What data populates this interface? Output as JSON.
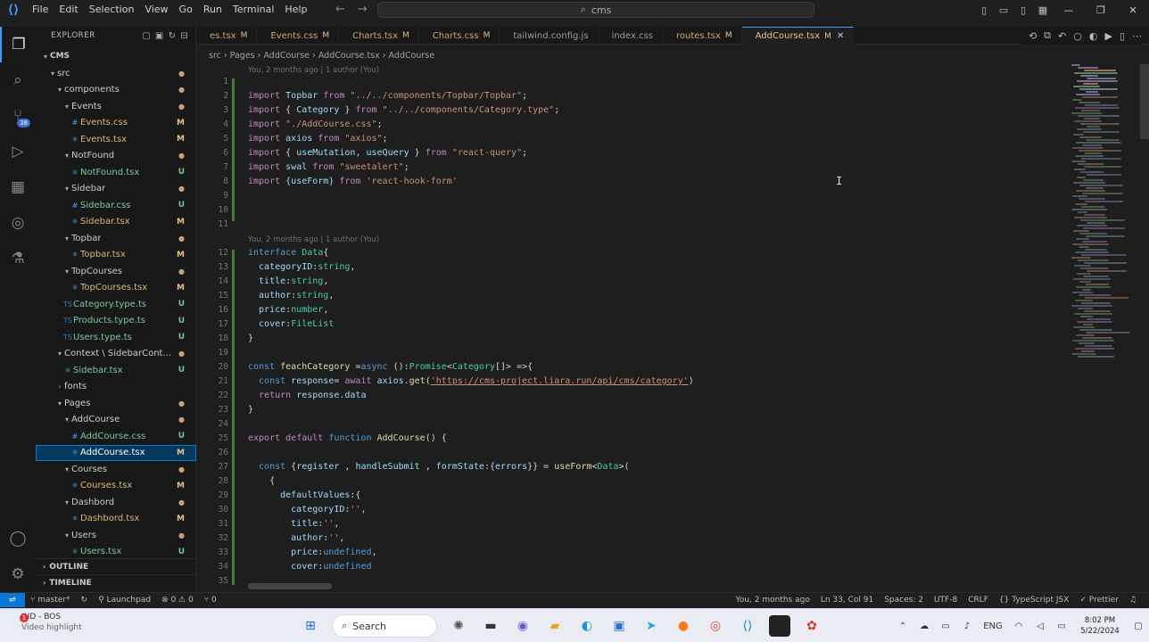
{
  "titlebar": {
    "logo": "⟨⟩",
    "menu": [
      "File",
      "Edit",
      "Selection",
      "View",
      "Go",
      "Run",
      "Terminal",
      "Help"
    ],
    "search_text": "cms",
    "icons": [
      "layout-sidebar-left-icon",
      "layout-panel-icon",
      "layout-sidebar-right-icon",
      "customize-layout-icon"
    ],
    "window": [
      "—",
      "❐",
      "✕"
    ]
  },
  "activity": [
    "explorer-icon",
    "search-icon",
    "source-control-icon",
    "run-debug-icon",
    "extensions-icon",
    "remote-explorer-icon",
    "testing-icon"
  ],
  "activity_badge": "38",
  "sidebar": {
    "title": "EXPLORER",
    "root": "CMS",
    "tree": [
      {
        "name": "src",
        "depth": 1,
        "kind": "folder",
        "status": "dot"
      },
      {
        "name": "components",
        "depth": 2,
        "kind": "folder",
        "status": "dot"
      },
      {
        "name": "Events",
        "depth": 3,
        "kind": "folder",
        "status": "dot"
      },
      {
        "name": "Events.css",
        "depth": 4,
        "kind": "css",
        "status": "M"
      },
      {
        "name": "Events.tsx",
        "depth": 4,
        "kind": "tsx",
        "status": "M"
      },
      {
        "name": "NotFound",
        "depth": 3,
        "kind": "folder",
        "status": "dot"
      },
      {
        "name": "NotFound.tsx",
        "depth": 4,
        "kind": "tsx",
        "status": "U"
      },
      {
        "name": "Sidebar",
        "depth": 3,
        "kind": "folder",
        "status": "dot"
      },
      {
        "name": "Sidebar.css",
        "depth": 4,
        "kind": "css",
        "status": "U"
      },
      {
        "name": "Sidebar.tsx",
        "depth": 4,
        "kind": "tsx",
        "status": "M"
      },
      {
        "name": "Topbar",
        "depth": 3,
        "kind": "folder",
        "status": "dot"
      },
      {
        "name": "Topbar.tsx",
        "depth": 4,
        "kind": "tsx",
        "status": "M"
      },
      {
        "name": "TopCourses",
        "depth": 3,
        "kind": "folder",
        "status": "dot"
      },
      {
        "name": "TopCourses.tsx",
        "depth": 4,
        "kind": "tsx",
        "status": "M"
      },
      {
        "name": "Category.type.ts",
        "depth": 3,
        "kind": "ts",
        "status": "U"
      },
      {
        "name": "Products.type.ts",
        "depth": 3,
        "kind": "ts",
        "status": "U"
      },
      {
        "name": "Users.type.ts",
        "depth": 3,
        "kind": "ts",
        "status": "U"
      },
      {
        "name": "Context \\ SidebarCont...",
        "depth": 2,
        "kind": "folder",
        "status": "dot"
      },
      {
        "name": "Sidebar.tsx",
        "depth": 3,
        "kind": "tsx",
        "status": "U"
      },
      {
        "name": "fonts",
        "depth": 2,
        "kind": "folder-closed",
        "status": ""
      },
      {
        "name": "Pages",
        "depth": 2,
        "kind": "folder",
        "status": "dot"
      },
      {
        "name": "AddCourse",
        "depth": 3,
        "kind": "folder",
        "status": "dot"
      },
      {
        "name": "AddCourse.css",
        "depth": 4,
        "kind": "css",
        "status": "U"
      },
      {
        "name": "AddCourse.tsx",
        "depth": 4,
        "kind": "tsx",
        "status": "M",
        "selected": true
      },
      {
        "name": "Courses",
        "depth": 3,
        "kind": "folder",
        "status": "dot"
      },
      {
        "name": "Courses.tsx",
        "depth": 4,
        "kind": "tsx",
        "status": "M"
      },
      {
        "name": "Dashbord",
        "depth": 3,
        "kind": "folder",
        "status": "dot"
      },
      {
        "name": "Dashbord.tsx",
        "depth": 4,
        "kind": "tsx",
        "status": "M"
      },
      {
        "name": "Users",
        "depth": 3,
        "kind": "folder",
        "status": "dot"
      },
      {
        "name": "Users.tsx",
        "depth": 4,
        "kind": "tsx",
        "status": "U"
      }
    ],
    "outline": "OUTLINE",
    "timeline": "TIMELINE"
  },
  "tabs": [
    {
      "name": "es.tsx",
      "icon": "⚛",
      "status": "M"
    },
    {
      "name": "Events.css",
      "icon": "#",
      "status": "M"
    },
    {
      "name": "Charts.tsx",
      "icon": "⚛",
      "status": "M"
    },
    {
      "name": "Charts.css",
      "icon": "#",
      "status": "M"
    },
    {
      "name": "tailwind.config.js",
      "icon": "JS",
      "status": ""
    },
    {
      "name": "index.css",
      "icon": "#",
      "status": ""
    },
    {
      "name": "routes.tsx",
      "icon": "⚛",
      "status": "M"
    },
    {
      "name": "AddCourse.tsx",
      "icon": "⚛",
      "status": "M",
      "active": true
    }
  ],
  "breadcrumb": [
    "src",
    "Pages",
    "AddCourse",
    "AddCourse.tsx",
    "AddCourse"
  ],
  "blame": {
    "top": "You, 2 months ago | 1 author (You)",
    "mid": "You, 2 months ago | 1 author (You)"
  },
  "code": [
    {
      "n": "1",
      "t": [
        [
          "",
          "pn"
        ]
      ]
    },
    {
      "n": "2",
      "t": [
        [
          "import ",
          "kw"
        ],
        [
          "Topbar ",
          "id"
        ],
        [
          "from ",
          "kw"
        ],
        [
          "\"../../components/Topbar/Topbar\"",
          "str"
        ],
        [
          ";",
          "pn"
        ]
      ]
    },
    {
      "n": "3",
      "t": [
        [
          "import ",
          "kw"
        ],
        [
          "{ ",
          "pn"
        ],
        [
          "Category ",
          "id"
        ],
        [
          "} ",
          "pn"
        ],
        [
          "from ",
          "kw"
        ],
        [
          "\"../../components/Category.type\"",
          "str"
        ],
        [
          ";",
          "pn"
        ]
      ]
    },
    {
      "n": "4",
      "t": [
        [
          "import ",
          "kw"
        ],
        [
          "\"./AddCourse.css\"",
          "str"
        ],
        [
          ";",
          "pn"
        ]
      ]
    },
    {
      "n": "5",
      "t": [
        [
          "import ",
          "kw"
        ],
        [
          "axios ",
          "id"
        ],
        [
          "from ",
          "kw"
        ],
        [
          "\"axios\"",
          "str"
        ],
        [
          ";",
          "pn"
        ]
      ]
    },
    {
      "n": "6",
      "t": [
        [
          "import ",
          "kw"
        ],
        [
          "{ ",
          "pn"
        ],
        [
          "useMutation",
          "id"
        ],
        [
          ", ",
          "pn"
        ],
        [
          "useQuery ",
          "id"
        ],
        [
          "} ",
          "pn"
        ],
        [
          "from ",
          "kw"
        ],
        [
          "\"react-query\"",
          "str"
        ],
        [
          ";",
          "pn"
        ]
      ]
    },
    {
      "n": "7",
      "t": [
        [
          "import ",
          "kw"
        ],
        [
          "swal ",
          "id"
        ],
        [
          "from ",
          "kw"
        ],
        [
          "\"sweetalert\"",
          "str"
        ],
        [
          ";",
          "pn"
        ]
      ]
    },
    {
      "n": "8",
      "t": [
        [
          "import ",
          "kw"
        ],
        [
          "{useForm} ",
          "id"
        ],
        [
          "from ",
          "kw"
        ],
        [
          "'react-hook-form'",
          "str"
        ]
      ]
    },
    {
      "n": "9",
      "t": [
        [
          "",
          "pn"
        ]
      ]
    },
    {
      "n": "10",
      "t": [
        [
          "",
          "pn"
        ]
      ]
    },
    {
      "n": "11",
      "t": [
        [
          "",
          "pn"
        ]
      ]
    },
    {
      "n": "12",
      "t": [
        [
          "interface ",
          "kw2"
        ],
        [
          "Data",
          "ty"
        ],
        [
          "{",
          "pn"
        ]
      ]
    },
    {
      "n": "13",
      "t": [
        [
          "  categoryID",
          "id"
        ],
        [
          ":",
          "pn"
        ],
        [
          "string",
          "ty"
        ],
        [
          ",",
          "pn"
        ]
      ]
    },
    {
      "n": "14",
      "t": [
        [
          "  title",
          "id"
        ],
        [
          ":",
          "pn"
        ],
        [
          "string",
          "ty"
        ],
        [
          ",",
          "pn"
        ]
      ]
    },
    {
      "n": "15",
      "t": [
        [
          "  author",
          "id"
        ],
        [
          ":",
          "pn"
        ],
        [
          "string",
          "ty"
        ],
        [
          ",",
          "pn"
        ]
      ]
    },
    {
      "n": "16",
      "t": [
        [
          "  price",
          "id"
        ],
        [
          ":",
          "pn"
        ],
        [
          "number",
          "ty"
        ],
        [
          ",",
          "pn"
        ]
      ]
    },
    {
      "n": "17",
      "t": [
        [
          "  cover",
          "id"
        ],
        [
          ":",
          "pn"
        ],
        [
          "FileList",
          "ty"
        ]
      ]
    },
    {
      "n": "18",
      "t": [
        [
          "}",
          "pn"
        ]
      ]
    },
    {
      "n": "19",
      "t": [
        [
          "",
          "pn"
        ]
      ]
    },
    {
      "n": "20",
      "t": [
        [
          "const ",
          "kw2"
        ],
        [
          "feachCategory ",
          "fn"
        ],
        [
          "=",
          "pn"
        ],
        [
          "async ",
          "kw2"
        ],
        [
          "():",
          "pn"
        ],
        [
          "Promise",
          "ty"
        ],
        [
          "<",
          "pn"
        ],
        [
          "Category",
          "ty"
        ],
        [
          "[]> =>{",
          "pn"
        ]
      ]
    },
    {
      "n": "21",
      "t": [
        [
          "  const ",
          "kw2"
        ],
        [
          "response",
          "id"
        ],
        [
          "= ",
          "pn"
        ],
        [
          "await ",
          "kw"
        ],
        [
          "axios",
          "id"
        ],
        [
          ".",
          "pn"
        ],
        [
          "get",
          "fn"
        ],
        [
          "(",
          "pn"
        ],
        [
          "'https://cms-project.liara.run/api/cms/category'",
          "url"
        ],
        [
          ")",
          "pn"
        ]
      ]
    },
    {
      "n": "22",
      "t": [
        [
          "  return ",
          "kw"
        ],
        [
          "response",
          "id"
        ],
        [
          ".",
          "pn"
        ],
        [
          "data",
          "id"
        ]
      ]
    },
    {
      "n": "23",
      "t": [
        [
          "}",
          "pn"
        ]
      ]
    },
    {
      "n": "24",
      "t": [
        [
          "",
          "pn"
        ]
      ]
    },
    {
      "n": "25",
      "t": [
        [
          "export ",
          "kw"
        ],
        [
          "default ",
          "kw"
        ],
        [
          "function ",
          "kw2"
        ],
        [
          "AddCourse",
          "fn"
        ],
        [
          "() {",
          "pn"
        ]
      ]
    },
    {
      "n": "26",
      "t": [
        [
          "",
          "pn"
        ]
      ]
    },
    {
      "n": "27",
      "t": [
        [
          "  const ",
          "kw2"
        ],
        [
          "{",
          "pn"
        ],
        [
          "register ",
          "id"
        ],
        [
          ", ",
          "pn"
        ],
        [
          "handleSubmit ",
          "id"
        ],
        [
          ", ",
          "pn"
        ],
        [
          "formState",
          "id"
        ],
        [
          ":{",
          "pn"
        ],
        [
          "errors",
          "id"
        ],
        [
          "}} = ",
          "pn"
        ],
        [
          "useForm",
          "fn"
        ],
        [
          "<",
          "pn"
        ],
        [
          "Data",
          "ty"
        ],
        [
          ">(",
          "pn"
        ]
      ]
    },
    {
      "n": "28",
      "t": [
        [
          "    {",
          "pn"
        ]
      ]
    },
    {
      "n": "29",
      "t": [
        [
          "      defaultValues",
          "id"
        ],
        [
          ":{",
          "pn"
        ]
      ]
    },
    {
      "n": "30",
      "t": [
        [
          "        categoryID",
          "id"
        ],
        [
          ":",
          "pn"
        ],
        [
          "''",
          "str"
        ],
        [
          ",",
          "pn"
        ]
      ]
    },
    {
      "n": "31",
      "t": [
        [
          "        title",
          "id"
        ],
        [
          ":",
          "pn"
        ],
        [
          "''",
          "str"
        ],
        [
          ",",
          "pn"
        ]
      ]
    },
    {
      "n": "32",
      "t": [
        [
          "        author",
          "id"
        ],
        [
          ":",
          "pn"
        ],
        [
          "''",
          "str"
        ],
        [
          ",",
          "pn"
        ]
      ]
    },
    {
      "n": "33",
      "t": [
        [
          "        price",
          "id"
        ],
        [
          ":",
          "pn"
        ],
        [
          "undefined",
          "kw2"
        ],
        [
          ",",
          "pn"
        ]
      ]
    },
    {
      "n": "34",
      "t": [
        [
          "        cover",
          "id"
        ],
        [
          ":",
          "pn"
        ],
        [
          "undefined",
          "kw2"
        ]
      ]
    },
    {
      "n": "35",
      "t": [
        [
          "",
          "pn"
        ]
      ]
    }
  ],
  "status": {
    "branch": "master*",
    "launchpad": "Launchpad",
    "problems": "⊗ 0  ⚠ 0",
    "ports": "⑂ 0",
    "right": [
      "You, 2 months ago",
      "Ln 33, Col 91",
      "Spaces: 2",
      "UTF-8",
      "CRLF",
      "{} TypeScript JSX",
      "✓ Prettier"
    ]
  },
  "taskbar": {
    "weather_title": "IND - BOS",
    "weather_sub": "Video highlight",
    "rec": "1",
    "search": "Search",
    "lang": "ENG",
    "time": "8:02 PM",
    "date": "5/22/2024"
  },
  "colors": {
    "accent": "#0a78d4",
    "editor_bg": "#1e1e1e",
    "modified": "#e2c08d",
    "untracked": "#73c991"
  }
}
